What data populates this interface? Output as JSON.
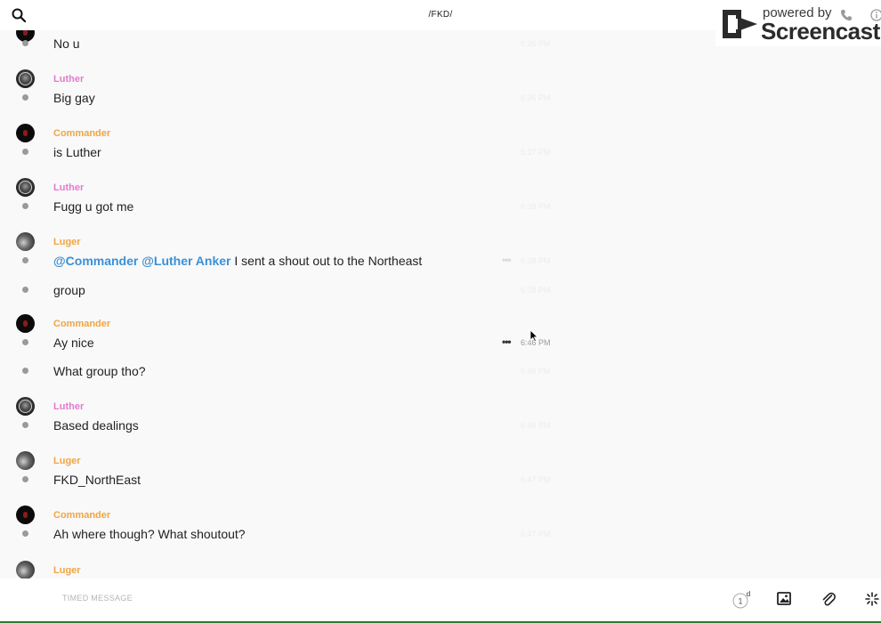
{
  "header": {
    "title": "/FKD/"
  },
  "watermark": {
    "powered_by": "powered by",
    "brand": "Screencastify"
  },
  "messages": [
    {
      "text": "No u",
      "time": "6:36 PM"
    },
    {
      "author": "Luther",
      "text": "Big gay",
      "time": "6:36 PM"
    },
    {
      "author": "Commander",
      "text": "is Luther",
      "time": "6:37 PM"
    },
    {
      "author": "Luther",
      "text": "Fugg u got me",
      "time": "6:38 PM"
    },
    {
      "author": "Luger",
      "mention1": "@Commander",
      "mention2": "@Luther Anker",
      "text": " I sent a shout out to the Northeast",
      "time": "6:38 PM"
    },
    {
      "text": "group",
      "time": "6:38 PM"
    },
    {
      "author": "Commander",
      "text": "Ay nice",
      "time": "6:46 PM"
    },
    {
      "text": "What group tho?",
      "time": "6:46 PM"
    },
    {
      "author": "Luther",
      "text": "Based dealings",
      "time": "6:46 PM"
    },
    {
      "author": "Luger",
      "text": "FKD_NorthEast",
      "time": "6:47 PM"
    },
    {
      "author": "Commander",
      "text": "Ah where though? What shoutout?",
      "time": "6:47 PM"
    },
    {
      "author": "Luger"
    }
  ],
  "composer": {
    "placeholder": "TIMED MESSAGE",
    "timer_value": "1",
    "timer_unit": "d"
  },
  "colors": {
    "luther": "#e27bd0",
    "commander": "#f0a545",
    "luger": "#f0a545",
    "mention": "#3b8fd6"
  }
}
